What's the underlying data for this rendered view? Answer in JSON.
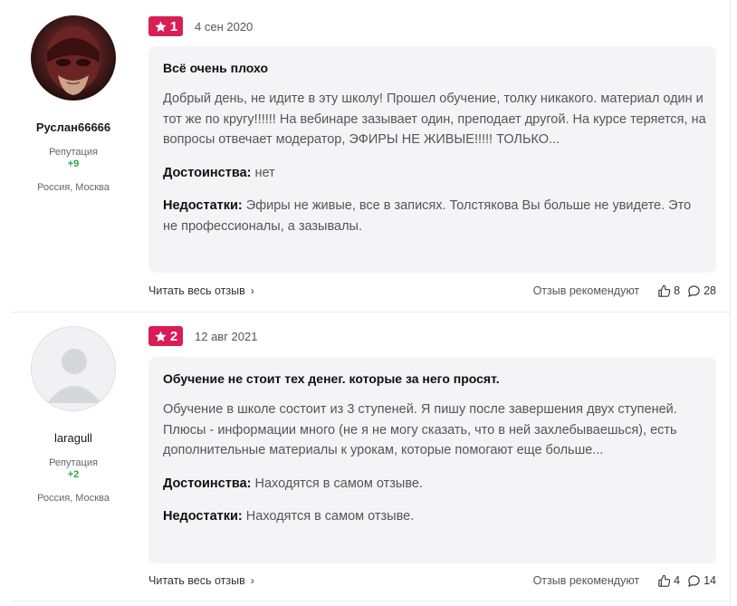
{
  "reviews": [
    {
      "author": {
        "name": "Руслан66666",
        "reputation_label": "Репутация",
        "reputation": "+9",
        "location": "Россия, Москва"
      },
      "rating": "1",
      "date": "4 сен 2020",
      "title": "Всё очень плохо",
      "text": "Добрый день, не идите в эту школу! Прошел обучение, толку никакого. материал один и тот же по кругу!!!!!! На вебинаре зазывает один, преподает другой. На курсе теряется, на вопросы отвечает модератор, ЭФИРЫ НЕ ЖИВЫЕ!!!!! ТОЛЬКО...",
      "pros_label": "Достоинства:",
      "pros": "нет",
      "cons_label": "Недостатки:",
      "cons": "Эфиры не живые, все в записях. Толстякова Вы больше не увидете. Это не профессионалы, а зазывалы.",
      "read_more": "Читать весь отзыв",
      "recommend_label": "Отзыв рекомендуют",
      "likes": "8",
      "comments": "28"
    },
    {
      "author": {
        "name": "laragull",
        "reputation_label": "Репутация",
        "reputation": "+2",
        "location": "Россия, Москва"
      },
      "rating": "2",
      "date": "12 авг 2021",
      "title": "Обучение не стоит тех денег. которые за него просят.",
      "text": "Обучение в школе состоит из 3 ступеней. Я пишу после завершения двух ступеней. Плюсы - информации много (не я не могу сказать, что в ней захлебываешься), есть дополнительные материалы к урокам, которые помогают еще больше...",
      "pros_label": "Достоинства:",
      "pros": "Находятся в самом отзыве.",
      "cons_label": "Недостатки:",
      "cons": "Находятся в самом отзыве.",
      "read_more": "Читать весь отзыв",
      "recommend_label": "Отзыв рекомендуют",
      "likes": "4",
      "comments": "14"
    }
  ],
  "colors": {
    "rating_badge": "#d91e55",
    "reputation": "#2fa64a",
    "card_bg": "#f4f4f6"
  },
  "icons": [
    "star-icon",
    "chevron-right-icon",
    "thumbs-up-icon",
    "comment-icon",
    "user-placeholder-icon"
  ]
}
